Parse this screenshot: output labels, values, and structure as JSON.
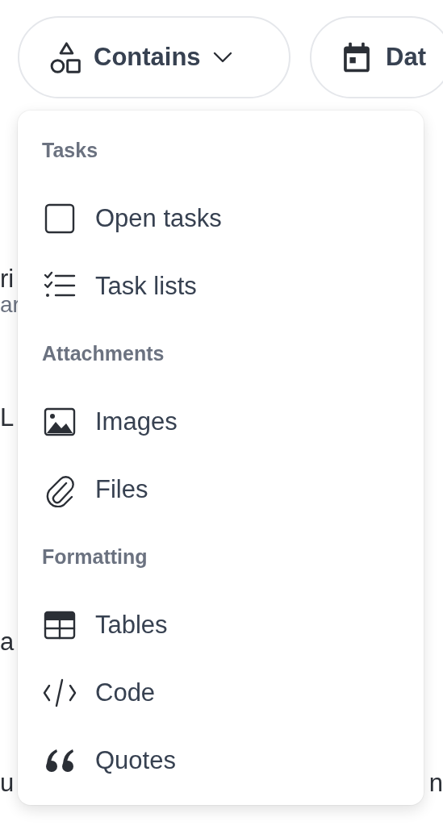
{
  "filters": [
    {
      "label": "Contains",
      "kind": "contains",
      "expanded": true
    },
    {
      "label": "Dat",
      "kind": "date"
    }
  ],
  "background": [
    {
      "left": "ri",
      "muted": false
    },
    {
      "left": "ar",
      "muted": true
    },
    {
      "left": "L",
      "muted": false
    },
    {
      "left": "a",
      "muted": false
    },
    {
      "left": "u",
      "right": "n",
      "muted": false
    }
  ],
  "menu": {
    "sections": [
      {
        "title": "Tasks",
        "items": [
          {
            "label": "Open tasks",
            "kind": "checkbox"
          },
          {
            "label": "Task lists",
            "kind": "checklist"
          }
        ]
      },
      {
        "title": "Attachments",
        "items": [
          {
            "label": "Images",
            "kind": "image"
          },
          {
            "label": "Files",
            "kind": "paperclip"
          }
        ]
      },
      {
        "title": "Formatting",
        "items": [
          {
            "label": "Tables",
            "kind": "table"
          },
          {
            "label": "Code",
            "kind": "code"
          },
          {
            "label": "Quotes",
            "kind": "quote"
          }
        ]
      }
    ]
  }
}
